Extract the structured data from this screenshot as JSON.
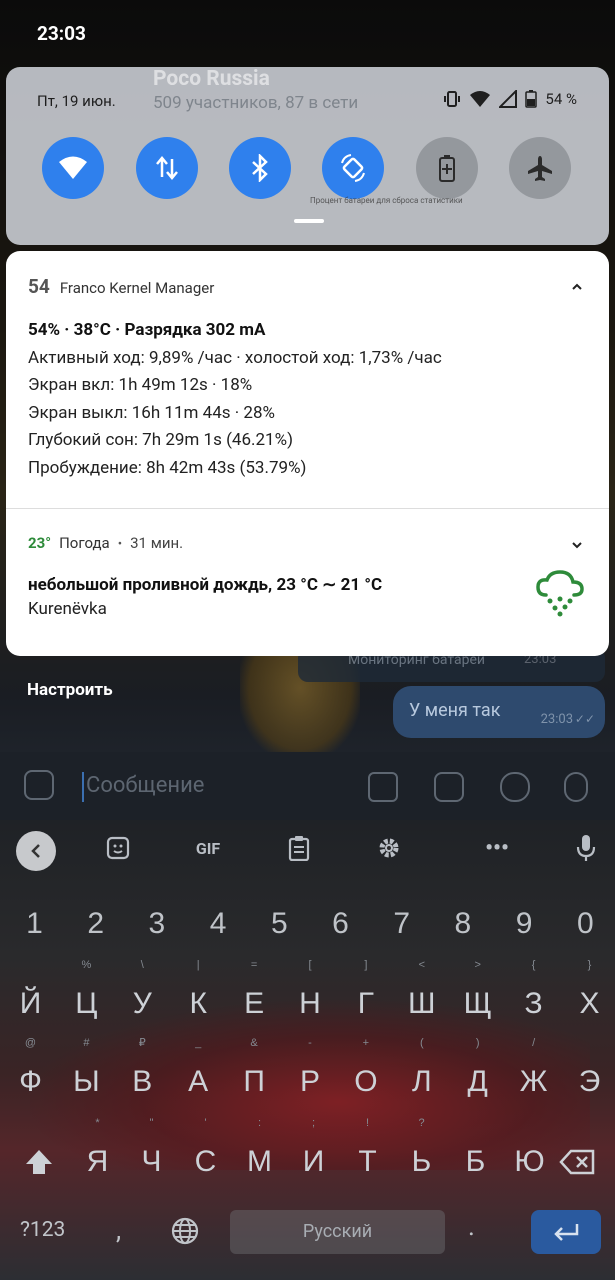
{
  "status_bar": {
    "time": "23:03"
  },
  "background_chat": {
    "group_name": "Poco Russia",
    "group_meta": "509 участников, 87 в сети",
    "reply_preview": "Мониторинг батареи",
    "reply_time": "23:03",
    "bubble_text": "У меня так",
    "bubble_time": "23:03",
    "message_placeholder": "Сообщение"
  },
  "quick_settings": {
    "date": "Пт, 19 июн.",
    "battery": "54 %",
    "hint": "Процент батареи для сброса статистики",
    "tiles": [
      {
        "name": "wifi",
        "state": "on"
      },
      {
        "name": "mobile-data",
        "state": "on"
      },
      {
        "name": "bluetooth",
        "state": "on"
      },
      {
        "name": "auto-rotate",
        "state": "on"
      },
      {
        "name": "battery-saver",
        "state": "off"
      },
      {
        "name": "airplane-mode",
        "state": "off"
      }
    ]
  },
  "notifications": {
    "franco": {
      "icon_text": "54",
      "app": "Franco Kernel Manager",
      "title": "54% · 38°C · Разрядка 302 mA",
      "lines": [
        "Активный ход: 9,89% /час · холостой ход: 1,73% /час",
        "Экран вкл: 1h 49m 12s  · 18%",
        "Экран выкл: 16h 11m 44s  · 28%",
        "Глубокий сон: 7h 29m 1s  (46.21%)",
        "Пробуждение: 8h 42m 43s  (53.79%)"
      ]
    },
    "weather": {
      "temp_icon": "23°",
      "app": "Погода",
      "separator": "•",
      "time": "31 мин.",
      "description": "небольшой проливной дождь,  23 °C    ∼ 21 °C",
      "location": "Kurenëvka"
    }
  },
  "customize_label": "Настроить",
  "keyboard": {
    "toolbar": {
      "gif": "GIF"
    },
    "numbers": [
      "1",
      "2",
      "3",
      "4",
      "5",
      "6",
      "7",
      "8",
      "9",
      "0"
    ],
    "row1": [
      {
        "k": "Й",
        "s": ""
      },
      {
        "k": "Ц",
        "s": "%"
      },
      {
        "k": "У",
        "s": "\\"
      },
      {
        "k": "К",
        "s": "|"
      },
      {
        "k": "Е",
        "s": "="
      },
      {
        "k": "Н",
        "s": "["
      },
      {
        "k": "Г",
        "s": "]"
      },
      {
        "k": "Ш",
        "s": "<"
      },
      {
        "k": "Щ",
        "s": ">"
      },
      {
        "k": "З",
        "s": "{"
      },
      {
        "k": "Х",
        "s": "}"
      }
    ],
    "row2": [
      {
        "k": "Ф",
        "s": "@"
      },
      {
        "k": "Ы",
        "s": "#"
      },
      {
        "k": "В",
        "s": "₽"
      },
      {
        "k": "А",
        "s": "_"
      },
      {
        "k": "П",
        "s": "&"
      },
      {
        "k": "Р",
        "s": "-"
      },
      {
        "k": "О",
        "s": "+"
      },
      {
        "k": "Л",
        "s": "("
      },
      {
        "k": "Д",
        "s": ")"
      },
      {
        "k": "Ж",
        "s": "/"
      },
      {
        "k": "Э",
        "s": ""
      }
    ],
    "row3": [
      {
        "k": "Я",
        "s": "*"
      },
      {
        "k": "Ч",
        "s": "\""
      },
      {
        "k": "С",
        "s": "'"
      },
      {
        "k": "М",
        "s": ":"
      },
      {
        "k": "И",
        "s": ";"
      },
      {
        "k": "Т",
        "s": "!"
      },
      {
        "k": "Ь",
        "s": "?"
      },
      {
        "k": "Б",
        "s": ""
      },
      {
        "k": "Ю",
        "s": ""
      }
    ],
    "symbols_key": "?123",
    "comma": ",",
    "space": "Русский",
    "period": "."
  }
}
